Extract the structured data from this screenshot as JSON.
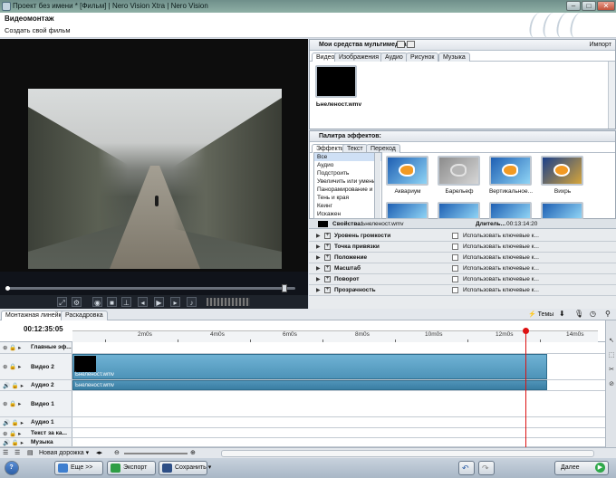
{
  "window": {
    "title": "Проект без имени * [Фильм] | Nero Vision Xtra | Nero Vision"
  },
  "header": {
    "title": "Видеомонтаж",
    "subtitle": "Создать свой фильм"
  },
  "media": {
    "title": "Мои средства мультимедиа",
    "import_label": "Импорт",
    "tabs": [
      "Видео",
      "Изображения",
      "Аудио",
      "Рисунок",
      "Музыка"
    ],
    "active_tab": "Видео",
    "clip_name": "Ьнеленост.wmv"
  },
  "effects": {
    "title": "Палитра эффектов:",
    "tabs": [
      "Эффекты",
      "Текст",
      "Переход"
    ],
    "list": [
      "Все",
      "Аудио",
      "Подстроить",
      "Увеличить или уменьш",
      "Панорамирование и м",
      "Тень и края",
      "Кеинг",
      "Искажен"
    ],
    "thumbs": [
      "Аквариум",
      "Барельеф",
      "Вертикальное...",
      "Вихрь"
    ]
  },
  "properties": {
    "label": "Свойства:",
    "file": "Ьнеленост.wmv",
    "duration_label": "Длитель...",
    "duration": "00:13:14:20",
    "keyframe_text": "Использовать ключевые к...",
    "rows": [
      "Уровень громкости",
      "Точка привязки",
      "Положение",
      "Масштаб",
      "Поворот",
      "Прозрачность"
    ]
  },
  "timeline": {
    "tabs": [
      "Монтажная линейка",
      "Раскадровка"
    ],
    "themes_label": "Темы",
    "timecode": "00:12:35:05",
    "ruler": [
      "2m0s",
      "4m0s",
      "6m0s",
      "8m0s",
      "10m0s",
      "12m0s",
      "14m0s"
    ],
    "tracks": [
      {
        "name": "Главные эф..."
      },
      {
        "name": "Видео 2"
      },
      {
        "name": "Аудио 2"
      },
      {
        "name": "Видео 1"
      },
      {
        "name": "Аудио 1"
      },
      {
        "name": "Текст за ка..."
      },
      {
        "name": "Музыка"
      }
    ],
    "clip_video": "Ьнеленост.wmv",
    "clip_audio": "Ьнеленост.wmv",
    "new_track": "Новая дорожка",
    "playhead_fraction": 0.862
  },
  "bottom": {
    "more": "Еще >>",
    "export": "Экспорт",
    "save": "Сохранить",
    "next": "Далее",
    "help": "?"
  }
}
